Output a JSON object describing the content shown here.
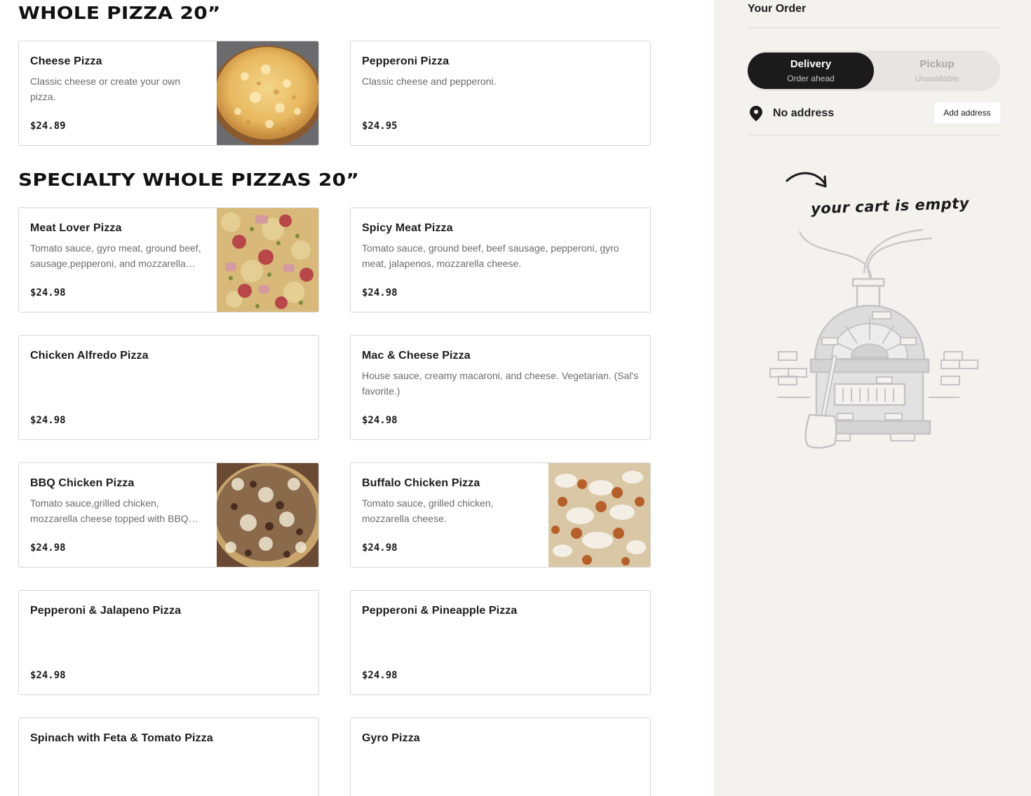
{
  "sections": [
    {
      "title": "WHOLE PIZZA 20”"
    },
    {
      "title": "SPECIALTY WHOLE PIZZAS 20”"
    }
  ],
  "items": [
    {
      "name": "Cheese Pizza",
      "desc": "Classic cheese or create your own pizza.",
      "price": "$24.89",
      "image": "pizza-photo-cheese"
    },
    {
      "name": "Pepperoni Pizza",
      "desc": "Classic cheese and pepperoni.",
      "price": "$24.95"
    },
    {
      "name": "Meat Lover Pizza",
      "desc": "Tomato sauce, gyro meat, ground beef, sausage,pepperoni, and mozzarella cheese.",
      "price": "$24.98",
      "image": "pizza-photo-meat-lover"
    },
    {
      "name": "Spicy Meat Pizza",
      "desc": "Tomato sauce, ground beef, beef sausage, pepperoni, gyro meat, jalapenos, mozzarella cheese.",
      "price": "$24.98"
    },
    {
      "name": "Chicken Alfredo Pizza",
      "desc": "",
      "price": "$24.98"
    },
    {
      "name": "Mac & Cheese Pizza",
      "desc": "House sauce, creamy macaroni, and cheese. Vegetarian. (Sal's favorite.)",
      "price": "$24.98"
    },
    {
      "name": "BBQ Chicken Pizza",
      "desc": "Tomato sauce,grilled chicken, mozzarella cheese topped with BBQ sauce.",
      "price": "$24.98",
      "image": "pizza-photo-bbq-chicken"
    },
    {
      "name": "Buffalo Chicken Pizza",
      "desc": "Tomato sauce, grilled chicken, mozzarella cheese.",
      "price": "$24.98",
      "image": "pizza-photo-buffalo-chicken"
    },
    {
      "name": "Pepperoni & Jalapeno Pizza",
      "desc": "",
      "price": "$24.98"
    },
    {
      "name": "Pepperoni & Pineapple Pizza",
      "desc": "",
      "price": "$24.98"
    },
    {
      "name": "Spinach with Feta & Tomato Pizza",
      "desc": "",
      "price": ""
    },
    {
      "name": "Gyro Pizza",
      "desc": "",
      "price": ""
    }
  ],
  "sidebar": {
    "title": "Your Order",
    "delivery": {
      "label": "Delivery",
      "sub": "Order ahead"
    },
    "pickup": {
      "label": "Pickup",
      "sub": "Unavailable"
    },
    "address": {
      "text": "No address",
      "button": "Add address",
      "icon": "map-pin-icon"
    },
    "empty_cart": {
      "text": "your cart is empty",
      "illustration": "pizza-oven-illustration"
    }
  },
  "colors": {
    "sidebar_bg": "#f3f2ef",
    "toggle_active": "#1b1b1b",
    "card_border": "#d6d6d6"
  }
}
